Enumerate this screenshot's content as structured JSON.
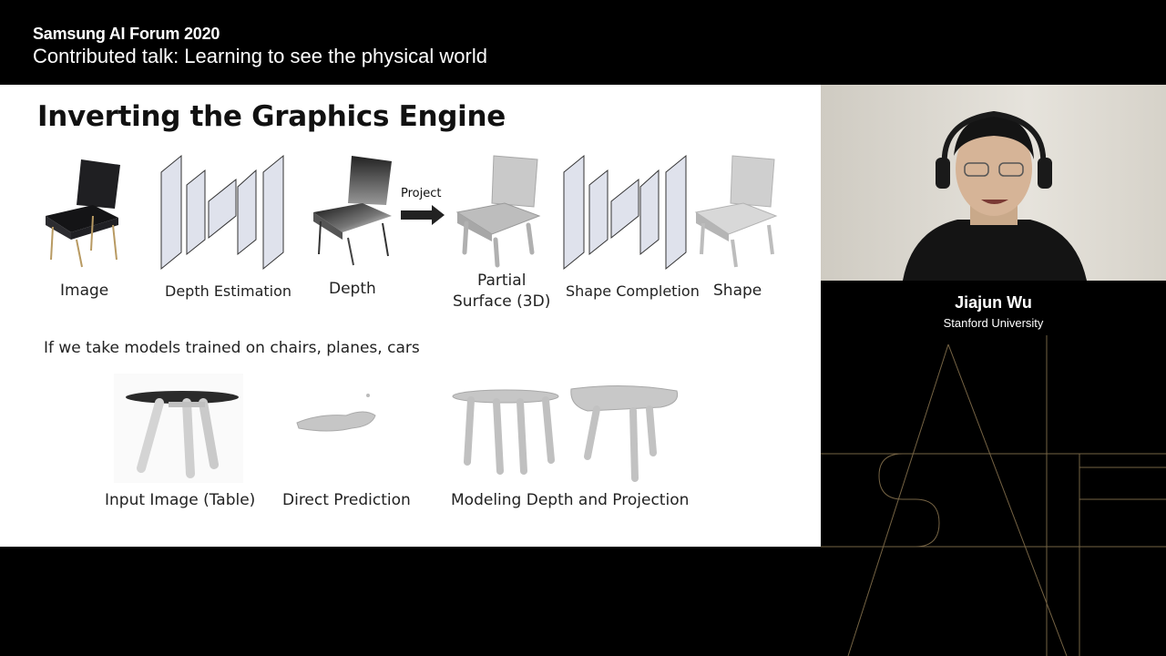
{
  "header": {
    "event": "Samsung AI Forum 2020",
    "talk": "Contributed talk: Learning to see the physical world"
  },
  "slide": {
    "title": "Inverting the Graphics Engine",
    "pipeline": {
      "image": "Image",
      "depth_estimation": "Depth Estimation",
      "depth": "Depth",
      "project": "Project",
      "partial_line1": "Partial",
      "partial_line2": "Surface (3D)",
      "shape_completion": "Shape Completion",
      "shape": "Shape"
    },
    "note": "If we take models trained on chairs, planes, cars",
    "results": {
      "input": "Input Image (Table)",
      "direct": "Direct Prediction",
      "modeling": "Modeling Depth and Projection"
    }
  },
  "speaker": {
    "name": "Jiajun Wu",
    "affiliation": "Stanford University"
  },
  "colors": {
    "accent_gold": "#8a7550",
    "slide_bg": "#ffffff",
    "network_block": "#dfe2ec"
  },
  "icons": [
    "arrow-right-icon",
    "sai-logo"
  ]
}
